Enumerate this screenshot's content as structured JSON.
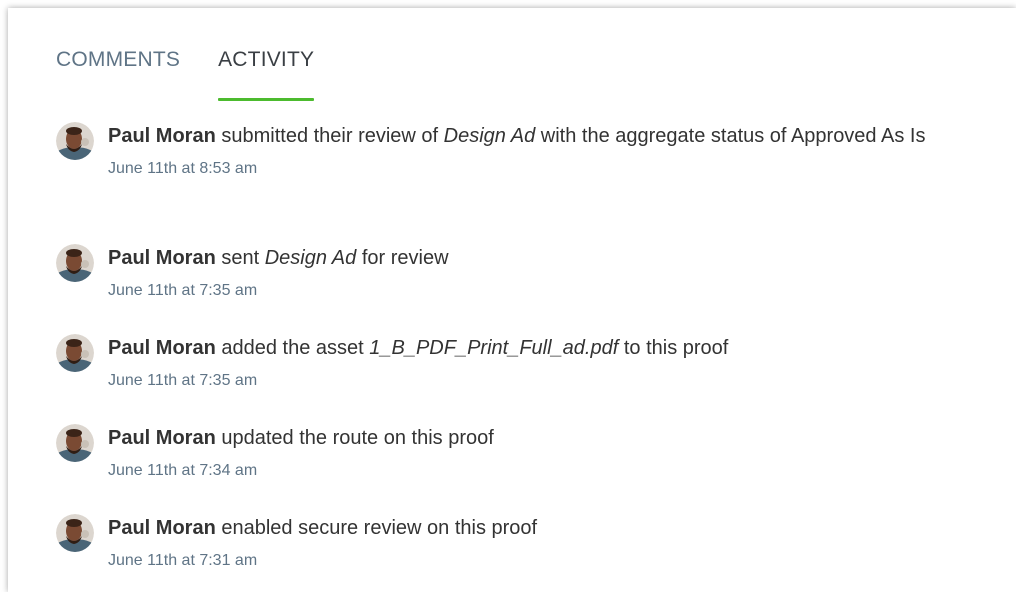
{
  "tabs": [
    {
      "label": "COMMENTS",
      "active": false
    },
    {
      "label": "ACTIVITY",
      "active": true
    }
  ],
  "colors": {
    "tab_underline": "#4cbb2e",
    "muted_text": "#5f7486",
    "body_text": "#333333"
  },
  "activities": [
    {
      "actor": "Paul Moran",
      "pre": " submitted their review of ",
      "target": "Design Ad",
      "post": " with the aggregate status of Approved As Is",
      "timestamp": "June 11th at 8:53 am"
    },
    {
      "actor": "Paul Moran",
      "pre": " sent ",
      "target": "Design Ad",
      "post": " for review",
      "timestamp": "June 11th at 7:35 am"
    },
    {
      "actor": "Paul Moran",
      "pre": " added the asset ",
      "target": "1_B_PDF_Print_Full_ad.pdf",
      "post": " to this proof",
      "timestamp": "June 11th at 7:35 am"
    },
    {
      "actor": "Paul Moran",
      "pre": " updated the route on this proof",
      "target": "",
      "post": "",
      "timestamp": "June 11th at 7:34 am"
    },
    {
      "actor": "Paul Moran",
      "pre": " enabled secure review on this proof",
      "target": "",
      "post": "",
      "timestamp": "June 11th at 7:31 am"
    }
  ]
}
